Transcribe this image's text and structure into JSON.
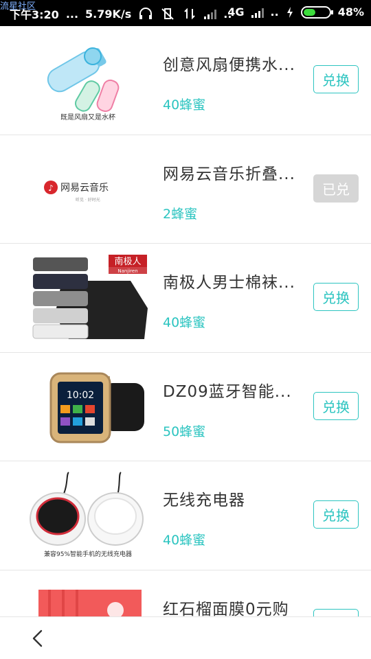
{
  "status_bar": {
    "watermark": "流星社区",
    "time": "下午3:20",
    "dots": "...",
    "speed": "5.79K/s",
    "dots2": "..",
    "network": "4G",
    "battery_percent": "48%",
    "battery_level": 0.48
  },
  "products": [
    {
      "title": "创意风扇便携水...",
      "price": "40蜂蜜",
      "button": "兑换",
      "status": "available",
      "image_caption": "既是风扇又是水杯"
    },
    {
      "title": "网易云音乐折叠...",
      "price": "2蜂蜜",
      "button": "已兑",
      "status": "redeemed",
      "image_caption": "网易云音乐",
      "image_subcaption": "听见 · 好时光"
    },
    {
      "title": "南极人男士棉袜...",
      "price": "40蜂蜜",
      "button": "兑换",
      "status": "available",
      "image_caption": "南极人",
      "image_subcaption": "Nanjiren"
    },
    {
      "title": "DZ09蓝牙智能...",
      "price": "50蜂蜜",
      "button": "兑换",
      "status": "available",
      "image_caption": "10:02"
    },
    {
      "title": "无线充电器",
      "price": "40蜂蜜",
      "button": "兑换",
      "status": "available",
      "image_caption": "兼容95%智能手机的无线充电器"
    },
    {
      "title": "红石榴面膜0元购",
      "price": "",
      "button": "",
      "status": "available"
    }
  ],
  "colors": {
    "accent": "#2bc4c0",
    "redeemed": "#d6d6d6",
    "title": "#333333"
  }
}
